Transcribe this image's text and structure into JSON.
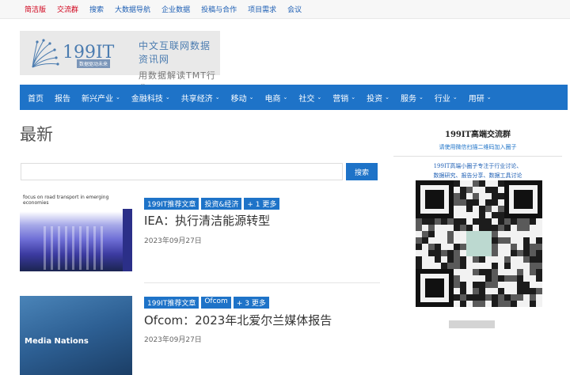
{
  "topbar": {
    "links": [
      "简洁版",
      "交流群",
      "搜索",
      "大数据导航",
      "企业数据",
      "投稿与合作",
      "项目需求",
      "会议"
    ]
  },
  "logo": {
    "mark_text": "199IT",
    "mark_tagline": "数据驱动未来",
    "line1": "中文互联网数据资讯网",
    "line2": "用数据解读TMT行业"
  },
  "nav": {
    "items": [
      {
        "label": "首页",
        "dropdown": false
      },
      {
        "label": "报告",
        "dropdown": false
      },
      {
        "label": "新兴产业",
        "dropdown": true
      },
      {
        "label": "金融科技",
        "dropdown": true
      },
      {
        "label": "共享经济",
        "dropdown": true
      },
      {
        "label": "移动",
        "dropdown": true
      },
      {
        "label": "电商",
        "dropdown": true
      },
      {
        "label": "社交",
        "dropdown": true
      },
      {
        "label": "营销",
        "dropdown": true
      },
      {
        "label": "投资",
        "dropdown": true
      },
      {
        "label": "服务",
        "dropdown": true
      },
      {
        "label": "行业",
        "dropdown": true
      },
      {
        "label": "用研",
        "dropdown": true
      }
    ]
  },
  "main": {
    "title": "最新",
    "search_value": "",
    "search_button": "搜索"
  },
  "articles": [
    {
      "tags": [
        "199IT推荐文章",
        "投资&经济",
        "+ 1 更多"
      ],
      "title": "IEA：执行清洁能源转型",
      "date": "2023年09月27日",
      "thumb_caption": "focus on road transport in emerging economies"
    },
    {
      "tags": [
        "199IT推荐文章",
        "Ofcom",
        "+ 3 更多"
      ],
      "title": "Ofcom：2023年北爱尔兰媒体报告",
      "date": "2023年09月27日",
      "thumb_caption": "Media Nations"
    }
  ],
  "sidebar": {
    "heading": "199IT高端交流群",
    "subheading": "请使用微信扫描二维码加入圈子",
    "desc_line1": "199IT高端小圈子专注于行业讨论、",
    "desc_line2": "数据研究、报告分享、数据工具讨论"
  },
  "colors": {
    "accent": "#1e73c8",
    "link": "#1e5fb4",
    "highlight_red": "#d0021b"
  }
}
